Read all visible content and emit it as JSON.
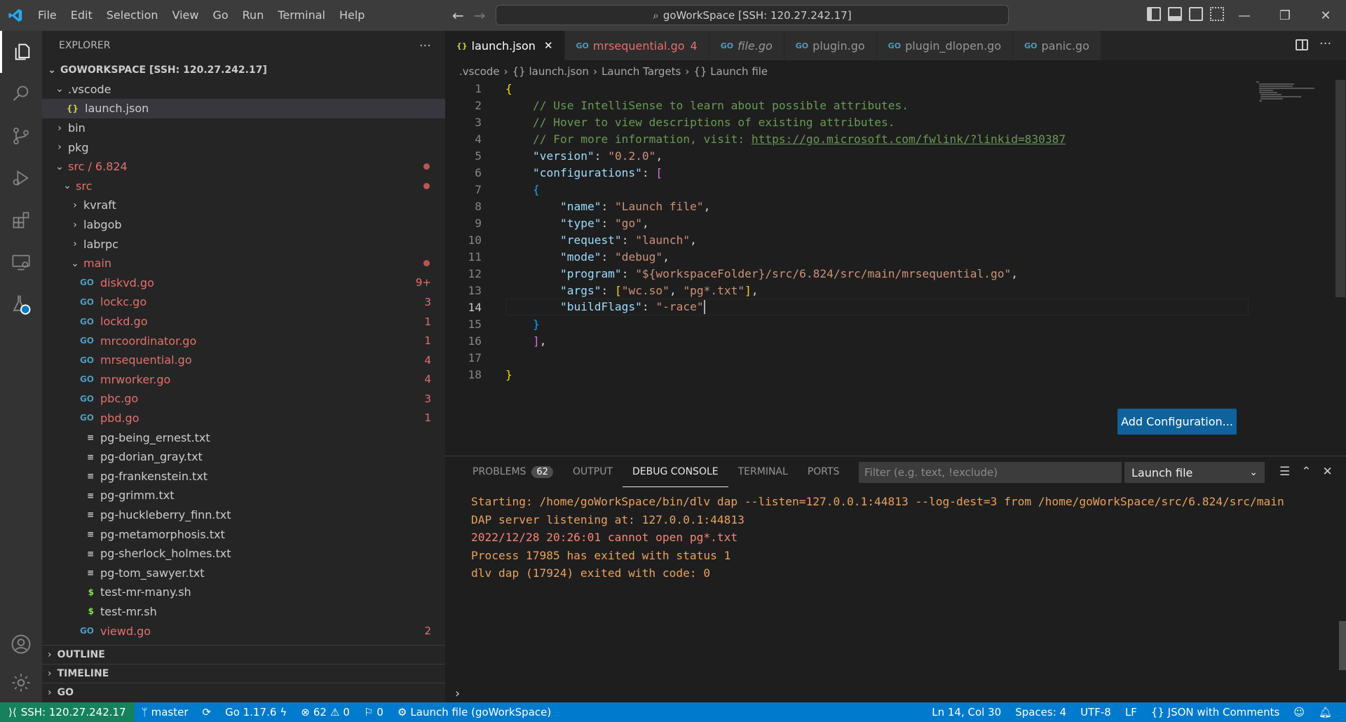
{
  "window": {
    "command_center": "goWorkSpace [SSH: 120.27.242.17]",
    "menu": [
      "File",
      "Edit",
      "Selection",
      "View",
      "Go",
      "Run",
      "Terminal",
      "Help"
    ]
  },
  "sidebar": {
    "title": "EXPLORER",
    "more": "···",
    "root": "GOWORKSPACE [SSH: 120.27.242.17]",
    "tree": [
      {
        "label": ".vscode",
        "type": "folder",
        "open": true,
        "indent": 1
      },
      {
        "label": "launch.json",
        "type": "json",
        "indent": 2,
        "selected": true
      },
      {
        "label": "bin",
        "type": "folder",
        "open": false,
        "indent": 1
      },
      {
        "label": "pkg",
        "type": "folder",
        "open": false,
        "indent": 1
      },
      {
        "label": "src / 6.824",
        "type": "folder",
        "open": true,
        "indent": 1,
        "modified": true,
        "dot": true
      },
      {
        "label": "src",
        "type": "folder",
        "open": true,
        "indent": 2,
        "modified": true,
        "dot": true
      },
      {
        "label": "kvraft",
        "type": "folder",
        "open": false,
        "indent": 3
      },
      {
        "label": "labgob",
        "type": "folder",
        "open": false,
        "indent": 3
      },
      {
        "label": "labrpc",
        "type": "folder",
        "open": false,
        "indent": 3
      },
      {
        "label": "main",
        "type": "folder",
        "open": true,
        "indent": 3,
        "modified": true,
        "dot": true
      },
      {
        "label": "diskvd.go",
        "type": "go",
        "indent": 4,
        "modified": true,
        "badge": "9+"
      },
      {
        "label": "lockc.go",
        "type": "go",
        "indent": 4,
        "modified": true,
        "badge": "3"
      },
      {
        "label": "lockd.go",
        "type": "go",
        "indent": 4,
        "modified": true,
        "badge": "1"
      },
      {
        "label": "mrcoordinator.go",
        "type": "go",
        "indent": 4,
        "modified": true,
        "badge": "1"
      },
      {
        "label": "mrsequential.go",
        "type": "go",
        "indent": 4,
        "modified": true,
        "badge": "4"
      },
      {
        "label": "mrworker.go",
        "type": "go",
        "indent": 4,
        "modified": true,
        "badge": "4"
      },
      {
        "label": "pbc.go",
        "type": "go",
        "indent": 4,
        "modified": true,
        "badge": "3"
      },
      {
        "label": "pbd.go",
        "type": "go",
        "indent": 4,
        "modified": true,
        "badge": "1"
      },
      {
        "label": "pg-being_ernest.txt",
        "type": "txt",
        "indent": 4
      },
      {
        "label": "pg-dorian_gray.txt",
        "type": "txt",
        "indent": 4
      },
      {
        "label": "pg-frankenstein.txt",
        "type": "txt",
        "indent": 4
      },
      {
        "label": "pg-grimm.txt",
        "type": "txt",
        "indent": 4
      },
      {
        "label": "pg-huckleberry_finn.txt",
        "type": "txt",
        "indent": 4
      },
      {
        "label": "pg-metamorphosis.txt",
        "type": "txt",
        "indent": 4
      },
      {
        "label": "pg-sherlock_holmes.txt",
        "type": "txt",
        "indent": 4
      },
      {
        "label": "pg-tom_sawyer.txt",
        "type": "txt",
        "indent": 4
      },
      {
        "label": "test-mr-many.sh",
        "type": "sh",
        "indent": 4
      },
      {
        "label": "test-mr.sh",
        "type": "sh",
        "indent": 4
      },
      {
        "label": "viewd.go",
        "type": "go",
        "indent": 4,
        "modified": true,
        "badge": "2"
      }
    ],
    "sections": [
      "OUTLINE",
      "TIMELINE",
      "GO"
    ]
  },
  "tabs": [
    {
      "label": "launch.json",
      "icon": "{}",
      "active": true,
      "close": "✕"
    },
    {
      "label": "mrsequential.go",
      "icon": "GO",
      "badge": "4",
      "modified": true
    },
    {
      "label": "file.go",
      "icon": "GO",
      "italic": true
    },
    {
      "label": "plugin.go",
      "icon": "GO"
    },
    {
      "label": "plugin_dlopen.go",
      "icon": "GO"
    },
    {
      "label": "panic.go",
      "icon": "GO"
    }
  ],
  "breadcrumb": [
    ".vscode",
    "{} launch.json",
    "Launch Targets",
    "{} Launch file"
  ],
  "code": [
    [
      {
        "t": "{",
        "c": "br1"
      }
    ],
    [
      {
        "t": "    // Use IntelliSense to learn about possible attributes.",
        "c": "cm"
      }
    ],
    [
      {
        "t": "    // Hover to view descriptions of existing attributes.",
        "c": "cm"
      }
    ],
    [
      {
        "t": "    // For more information, visit: ",
        "c": "cm"
      },
      {
        "t": "https://go.microsoft.com/fwlink/?linkid=830387",
        "c": "link"
      }
    ],
    [
      {
        "t": "    \"version\"",
        "c": "key"
      },
      {
        "t": ": ",
        "c": "pun"
      },
      {
        "t": "\"0.2.0\"",
        "c": "str"
      },
      {
        "t": ",",
        "c": "pun"
      }
    ],
    [
      {
        "t": "    \"configurations\"",
        "c": "key"
      },
      {
        "t": ": ",
        "c": "pun"
      },
      {
        "t": "[",
        "c": "br2"
      }
    ],
    [
      {
        "t": "    ",
        "c": "pun"
      },
      {
        "t": "{",
        "c": "br3"
      }
    ],
    [
      {
        "t": "        \"name\"",
        "c": "key"
      },
      {
        "t": ": ",
        "c": "pun"
      },
      {
        "t": "\"Launch file\"",
        "c": "str"
      },
      {
        "t": ",",
        "c": "pun"
      }
    ],
    [
      {
        "t": "        \"type\"",
        "c": "key"
      },
      {
        "t": ": ",
        "c": "pun"
      },
      {
        "t": "\"go\"",
        "c": "str"
      },
      {
        "t": ",",
        "c": "pun"
      }
    ],
    [
      {
        "t": "        \"request\"",
        "c": "key"
      },
      {
        "t": ": ",
        "c": "pun"
      },
      {
        "t": "\"launch\"",
        "c": "str"
      },
      {
        "t": ",",
        "c": "pun"
      }
    ],
    [
      {
        "t": "        \"mode\"",
        "c": "key"
      },
      {
        "t": ": ",
        "c": "pun"
      },
      {
        "t": "\"debug\"",
        "c": "str"
      },
      {
        "t": ",",
        "c": "pun"
      }
    ],
    [
      {
        "t": "        \"program\"",
        "c": "key"
      },
      {
        "t": ": ",
        "c": "pun"
      },
      {
        "t": "\"${workspaceFolder}/src/6.824/src/main/mrsequential.go\"",
        "c": "str"
      },
      {
        "t": ",",
        "c": "pun"
      }
    ],
    [
      {
        "t": "        \"args\"",
        "c": "key"
      },
      {
        "t": ": ",
        "c": "pun"
      },
      {
        "t": "[",
        "c": "br1"
      },
      {
        "t": "\"wc.so\"",
        "c": "str"
      },
      {
        "t": ", ",
        "c": "pun"
      },
      {
        "t": "\"pg*.txt\"",
        "c": "str"
      },
      {
        "t": "]",
        "c": "br1"
      },
      {
        "t": ",",
        "c": "pun"
      }
    ],
    [
      {
        "t": "        \"buildFlags\"",
        "c": "key"
      },
      {
        "t": ": ",
        "c": "pun"
      },
      {
        "t": "\"-race\"",
        "c": "str"
      }
    ],
    [
      {
        "t": "    ",
        "c": "pun"
      },
      {
        "t": "}",
        "c": "br3"
      }
    ],
    [
      {
        "t": "    ",
        "c": "pun"
      },
      {
        "t": "]",
        "c": "br2"
      },
      {
        "t": ",",
        "c": "pun"
      }
    ],
    [
      {
        "t": "",
        "c": "pun"
      }
    ],
    [
      {
        "t": "}",
        "c": "br1"
      }
    ]
  ],
  "current_line": 14,
  "add_config_label": "Add Configuration...",
  "panel": {
    "tabs": [
      {
        "label": "PROBLEMS",
        "count": "62"
      },
      {
        "label": "OUTPUT"
      },
      {
        "label": "DEBUG CONSOLE",
        "active": true
      },
      {
        "label": "TERMINAL"
      },
      {
        "label": "PORTS"
      }
    ],
    "filter_placeholder": "Filter (e.g. text, !exclude)",
    "launch_select": "Launch file",
    "console": [
      {
        "t": "Starting: /home/goWorkSpace/bin/dlv dap --listen=127.0.0.1:44813 --log-dest=3 from /home/goWorkSpace/src/6.824/src/main",
        "c": "c-orange"
      },
      {
        "t": "DAP server listening at: 127.0.0.1:44813",
        "c": "c-orange"
      },
      {
        "t": "2022/12/28 20:26:01 cannot open pg*.txt",
        "c": "c-red"
      },
      {
        "t": "Process 17985 has exited with status 1",
        "c": "c-orange"
      },
      {
        "t": "dlv dap (17924) exited with code: 0",
        "c": "c-orange"
      }
    ],
    "prompt": "›"
  },
  "status": {
    "remote": "SSH: 120.27.242.17",
    "branch": "master",
    "go_version": "Go 1.17.6",
    "errors": "62",
    "warnings": "0",
    "ports": "0",
    "debug": "Launch file (goWorkSpace)",
    "position": "Ln 14, Col 30",
    "spaces": "Spaces: 4",
    "encoding": "UTF-8",
    "eol": "LF",
    "language": "{} JSON with Comments"
  },
  "colors": {
    "accent": "#007acc",
    "remote": "#16825d",
    "modified": "#e2716b"
  }
}
